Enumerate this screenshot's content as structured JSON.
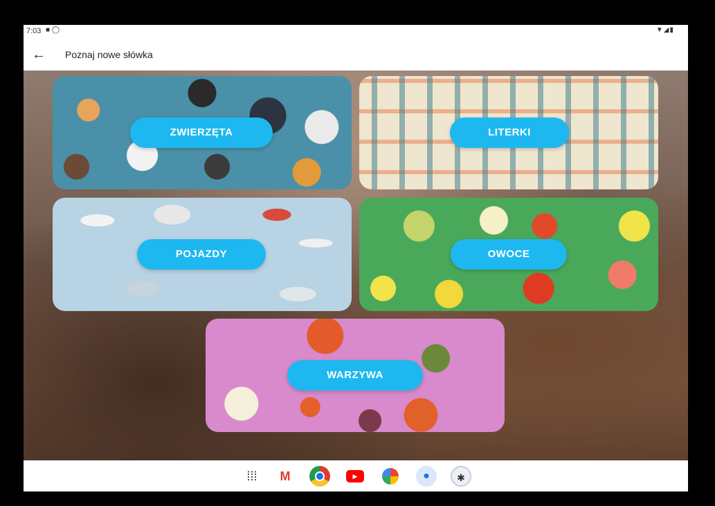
{
  "status_bar": {
    "time": "7:03",
    "left_icons": [
      "sd-card-icon",
      "sync-icon"
    ],
    "right_icons": [
      "wifi-icon",
      "signal-icon",
      "battery-icon"
    ]
  },
  "app_bar": {
    "title": "Poznaj nowe słówka",
    "back_icon": "arrow-left-icon"
  },
  "categories": [
    {
      "label": "ZWIERZĘTA",
      "theme": "animals"
    },
    {
      "label": "LITERKI",
      "theme": "letters"
    },
    {
      "label": "POJAZDY",
      "theme": "vehicles"
    },
    {
      "label": "OWOCE",
      "theme": "fruits"
    },
    {
      "label": "WARZYWA",
      "theme": "vegetables"
    }
  ],
  "button_color": "#1eb8f0",
  "dock": [
    {
      "name": "app-drawer-icon"
    },
    {
      "name": "gmail-icon"
    },
    {
      "name": "chrome-icon"
    },
    {
      "name": "youtube-icon"
    },
    {
      "name": "photos-icon"
    },
    {
      "name": "messages-icon"
    },
    {
      "name": "app-icon"
    }
  ]
}
